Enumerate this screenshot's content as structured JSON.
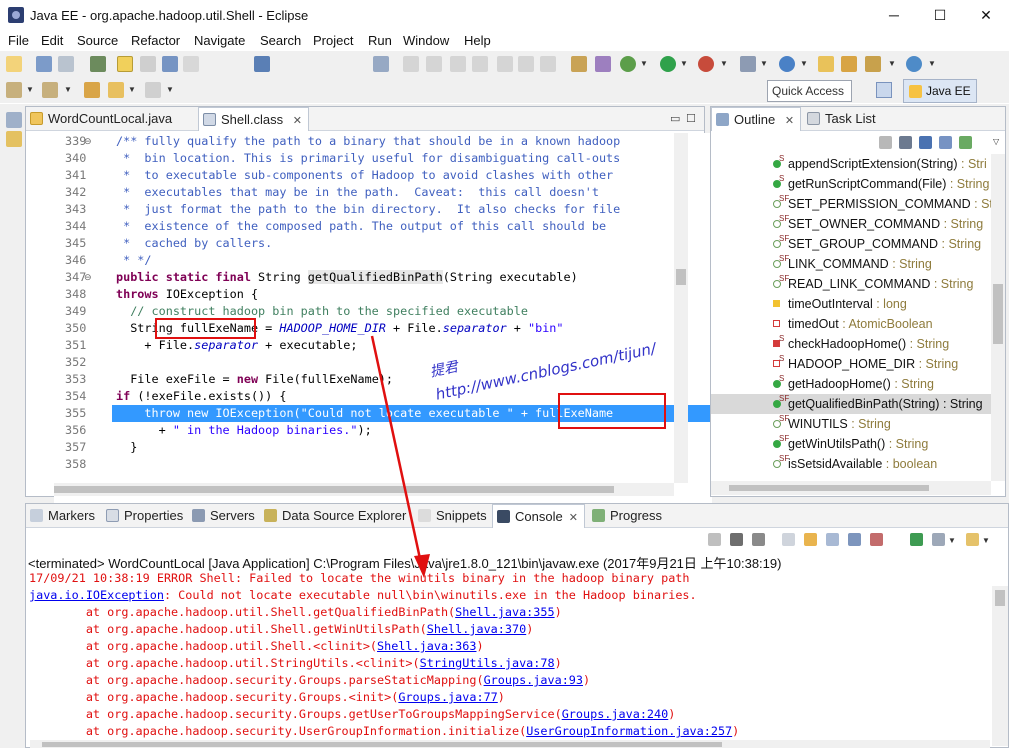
{
  "window": {
    "title": "Java EE - org.apache.hadoop.util.Shell - Eclipse",
    "minimize": "─",
    "maximize": "☐",
    "close": "✕"
  },
  "menu": [
    "File",
    "Edit",
    "Source",
    "Refactor",
    "Navigate",
    "Search",
    "Project",
    "Run",
    "Window",
    "Help"
  ],
  "toolbar": {
    "quick_access_placeholder": "Quick Access",
    "perspective": "Java EE"
  },
  "editor": {
    "tabs": [
      {
        "label": "WordCountLocal.java"
      },
      {
        "label": "Shell.class"
      }
    ],
    "lines": [
      {
        "n": "339",
        "text": "/** fully qualify the path to a binary that should be in a known hadoop"
      },
      {
        "n": "340",
        "text": " *  bin location. This is primarily useful for disambiguating call-outs"
      },
      {
        "n": "341",
        "text": " *  to executable sub-components of Hadoop to avoid clashes with other"
      },
      {
        "n": "342",
        "text": " *  executables that may be in the path.  Caveat:  this call doesn't"
      },
      {
        "n": "343",
        "text": " *  just format the path to the bin directory.  It also checks for file"
      },
      {
        "n": "344",
        "text": " *  existence of the composed path. The output of this call should be"
      },
      {
        "n": "345",
        "text": " *  cached by callers."
      },
      {
        "n": "346",
        "text": " * */"
      },
      {
        "n": "347",
        "kw": "public static final",
        "text": " String ",
        "occ": "getQualifiedBinPath",
        "rest": "(String executable)"
      },
      {
        "n": "348",
        "kw": "throws",
        "text": " IOException {"
      },
      {
        "n": "349",
        "cmt": "  // construct hadoop bin path to the specified executable"
      },
      {
        "n": "350",
        "pre": "  String ",
        "var": "fullExeName",
        "eq": " = ",
        "fld": "HADOOP_HOME_DIR",
        "mid": " + File.",
        "fld2": "separator",
        "plus": " + ",
        "str": "\"bin\""
      },
      {
        "n": "351",
        "pre": "    + File.",
        "fld": "separator",
        "rest": " + executable;"
      },
      {
        "n": "352",
        "text": ""
      },
      {
        "n": "353",
        "text": "  File exeFile = ",
        "kw": "new",
        "rest": " File(fullExeName);"
      },
      {
        "n": "354",
        "kw": "if",
        "text": " (!exeFile.exists()) {"
      },
      {
        "n": "355",
        "text": "    throw new IOException(\"Could not locate executable \" + fullExeName"
      },
      {
        "n": "356",
        "pre": "      + ",
        "str": "\" in the Hadoop binaries.\"",
        "rest": ");"
      },
      {
        "n": "357",
        "text": "  }"
      },
      {
        "n": "358",
        "text": ""
      }
    ]
  },
  "watermark": {
    "line1": "提君",
    "line2": "http://www.cnblogs.com/tijun/"
  },
  "outline": {
    "tabs": [
      {
        "label": "Outline"
      },
      {
        "label": "Task List"
      }
    ],
    "items": [
      {
        "name": "appendScriptExtension(String)",
        "type": " : Stri",
        "icon": "method-icon",
        "color": "#35a843",
        "sup": "S"
      },
      {
        "name": "getRunScriptCommand(File)",
        "type": " : String",
        "icon": "method-icon",
        "color": "#35a843",
        "sup": "S"
      },
      {
        "name": "SET_PERMISSION_COMMAND",
        "type": " : Str",
        "icon": "field-icon",
        "color": "#fff",
        "sup": "SF"
      },
      {
        "name": "SET_OWNER_COMMAND",
        "type": " : String",
        "icon": "field-icon",
        "color": "#fff",
        "sup": "SF"
      },
      {
        "name": "SET_GROUP_COMMAND",
        "type": " : String",
        "icon": "field-icon",
        "color": "#fff",
        "sup": "SF"
      },
      {
        "name": "LINK_COMMAND",
        "type": " : String",
        "icon": "field-icon",
        "color": "#fff",
        "sup": "SF"
      },
      {
        "name": "READ_LINK_COMMAND",
        "type": " : String",
        "icon": "field-icon",
        "color": "#fff",
        "sup": "SF"
      },
      {
        "name": "timeOutInterval",
        "type": " : long",
        "icon": "field-icon",
        "color": "#f2c230",
        "sup": ""
      },
      {
        "name": "timedOut",
        "type": " : AtomicBoolean",
        "icon": "field-icon",
        "color": "#e04040",
        "sup": ""
      },
      {
        "name": "checkHadoopHome()",
        "type": " : String",
        "icon": "method-icon",
        "color": "#e04040",
        "sup": "S"
      },
      {
        "name": "HADOOP_HOME_DIR",
        "type": " : String",
        "icon": "field-icon",
        "color": "#e04040",
        "sup": "S"
      },
      {
        "name": "getHadoopHome()",
        "type": " : String",
        "icon": "method-icon",
        "color": "#35a843",
        "sup": "S"
      },
      {
        "name": "getQualifiedBinPath(String)",
        "type": " : String",
        "icon": "method-icon",
        "color": "#35a843",
        "sup": "SF"
      },
      {
        "name": "WINUTILS",
        "type": " : String",
        "icon": "field-icon",
        "color": "#fff",
        "sup": "SF"
      },
      {
        "name": "getWinUtilsPath()",
        "type": " : String",
        "icon": "method-icon",
        "color": "#35a843",
        "sup": "SF"
      },
      {
        "name": "isSetsidAvailable",
        "type": " : boolean",
        "icon": "field-icon",
        "color": "#fff",
        "sup": "SF"
      }
    ]
  },
  "bottom": {
    "tabs": [
      {
        "label": "Markers"
      },
      {
        "label": "Properties"
      },
      {
        "label": "Servers"
      },
      {
        "label": "Data Source Explorer"
      },
      {
        "label": "Snippets"
      },
      {
        "label": "Console"
      },
      {
        "label": "Progress"
      }
    ],
    "console_header": "<terminated> WordCountLocal [Java Application] C:\\Program Files\\Java\\jre1.8.0_121\\bin\\javaw.exe (2017年9月21日 上午10:38:19)",
    "lines": [
      {
        "text": "17/09/21 10:38:19 ERROR Shell: Failed to locate the winutils binary in the hadoop binary path"
      },
      {
        "link_first": "java.io.IOException",
        "text": ": Could not locate executable null\\bin\\winutils.exe in the Hadoop binaries."
      },
      {
        "text": "\tat org.apache.hadoop.util.Shell.getQualifiedBinPath(",
        "link": "Shell.java:355",
        "end": ")"
      },
      {
        "text": "\tat org.apache.hadoop.util.Shell.getWinUtilsPath(",
        "link": "Shell.java:370",
        "end": ")"
      },
      {
        "text": "\tat org.apache.hadoop.util.Shell.<clinit>(",
        "link": "Shell.java:363",
        "end": ")"
      },
      {
        "text": "\tat org.apache.hadoop.util.StringUtils.<clinit>(",
        "link": "StringUtils.java:78",
        "end": ")"
      },
      {
        "text": "\tat org.apache.hadoop.security.Groups.parseStaticMapping(",
        "link": "Groups.java:93",
        "end": ")"
      },
      {
        "text": "\tat org.apache.hadoop.security.Groups.<init>(",
        "link": "Groups.java:77",
        "end": ")"
      },
      {
        "text": "\tat org.apache.hadoop.security.Groups.getUserToGroupsMappingService(",
        "link": "Groups.java:240",
        "end": ")"
      },
      {
        "text": "\tat org.apache.hadoop.security.UserGroupInformation.initialize(",
        "link": "UserGroupInformation.java:257",
        "end": ")"
      }
    ]
  }
}
